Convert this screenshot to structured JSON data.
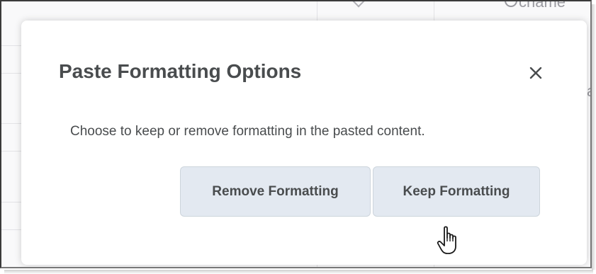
{
  "background": {
    "search_text": "chame",
    "partial_text": "a"
  },
  "dialog": {
    "title": "Paste Formatting Options",
    "close_label": "×",
    "description": "Choose to keep or remove formatting in the pasted content.",
    "buttons": {
      "remove": "Remove Formatting",
      "keep": "Keep Formatting"
    }
  },
  "colors": {
    "button_bg": "#e3e9f1",
    "text": "#494c4e"
  },
  "icons": {
    "close": "close-icon",
    "cursor": "hand-pointer-icon",
    "search": "search-icon"
  }
}
